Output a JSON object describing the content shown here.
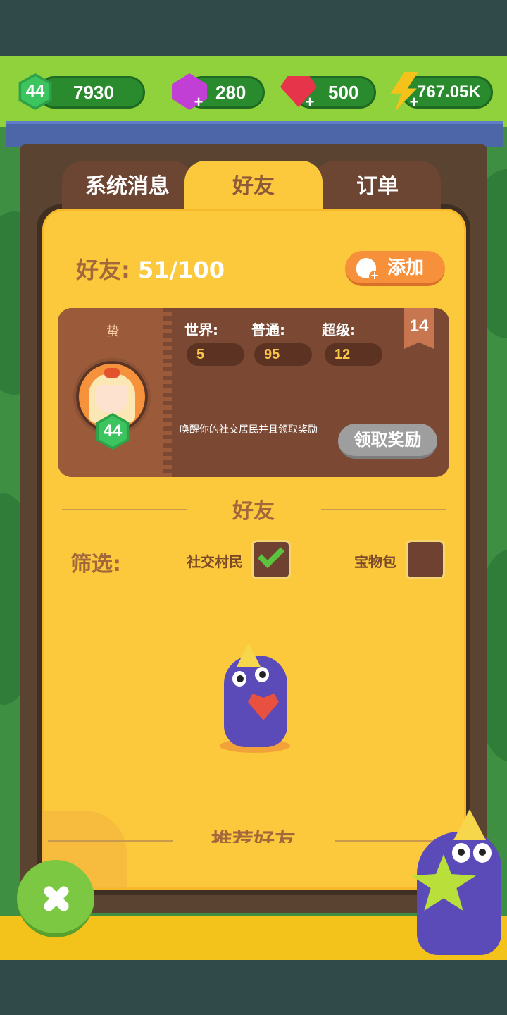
{
  "currency": {
    "level": "44",
    "coins": "7930",
    "gems_purple": "280",
    "gems_red": "500",
    "energy": "767.05K"
  },
  "tabs": [
    {
      "label": "系统消息",
      "active": false
    },
    {
      "label": "好友",
      "active": true
    },
    {
      "label": "订单",
      "active": false
    }
  ],
  "friends": {
    "label": "好友:",
    "count": "51/100",
    "add_label": "添加"
  },
  "profile": {
    "name": "蛰",
    "level": "44",
    "stats": [
      {
        "label": "世界:",
        "value": "5"
      },
      {
        "label": "普通:",
        "value": "95"
      },
      {
        "label": "超级:",
        "value": "12"
      }
    ],
    "ribbon": "14",
    "message": "唤醒你的社交居民并且领取奖励",
    "claim_label": "领取奖励"
  },
  "friends_section": {
    "title": "好友",
    "filter_label": "筛选:",
    "filters": [
      {
        "label": "社交村民",
        "checked": true
      },
      {
        "label": "宝物包",
        "checked": false
      }
    ]
  },
  "recommend_title": "推荐好友",
  "colors": {
    "panel": "#fdc93c",
    "accent_brown": "#a2683c",
    "card": "#7a4833",
    "green": "#7dc843"
  }
}
